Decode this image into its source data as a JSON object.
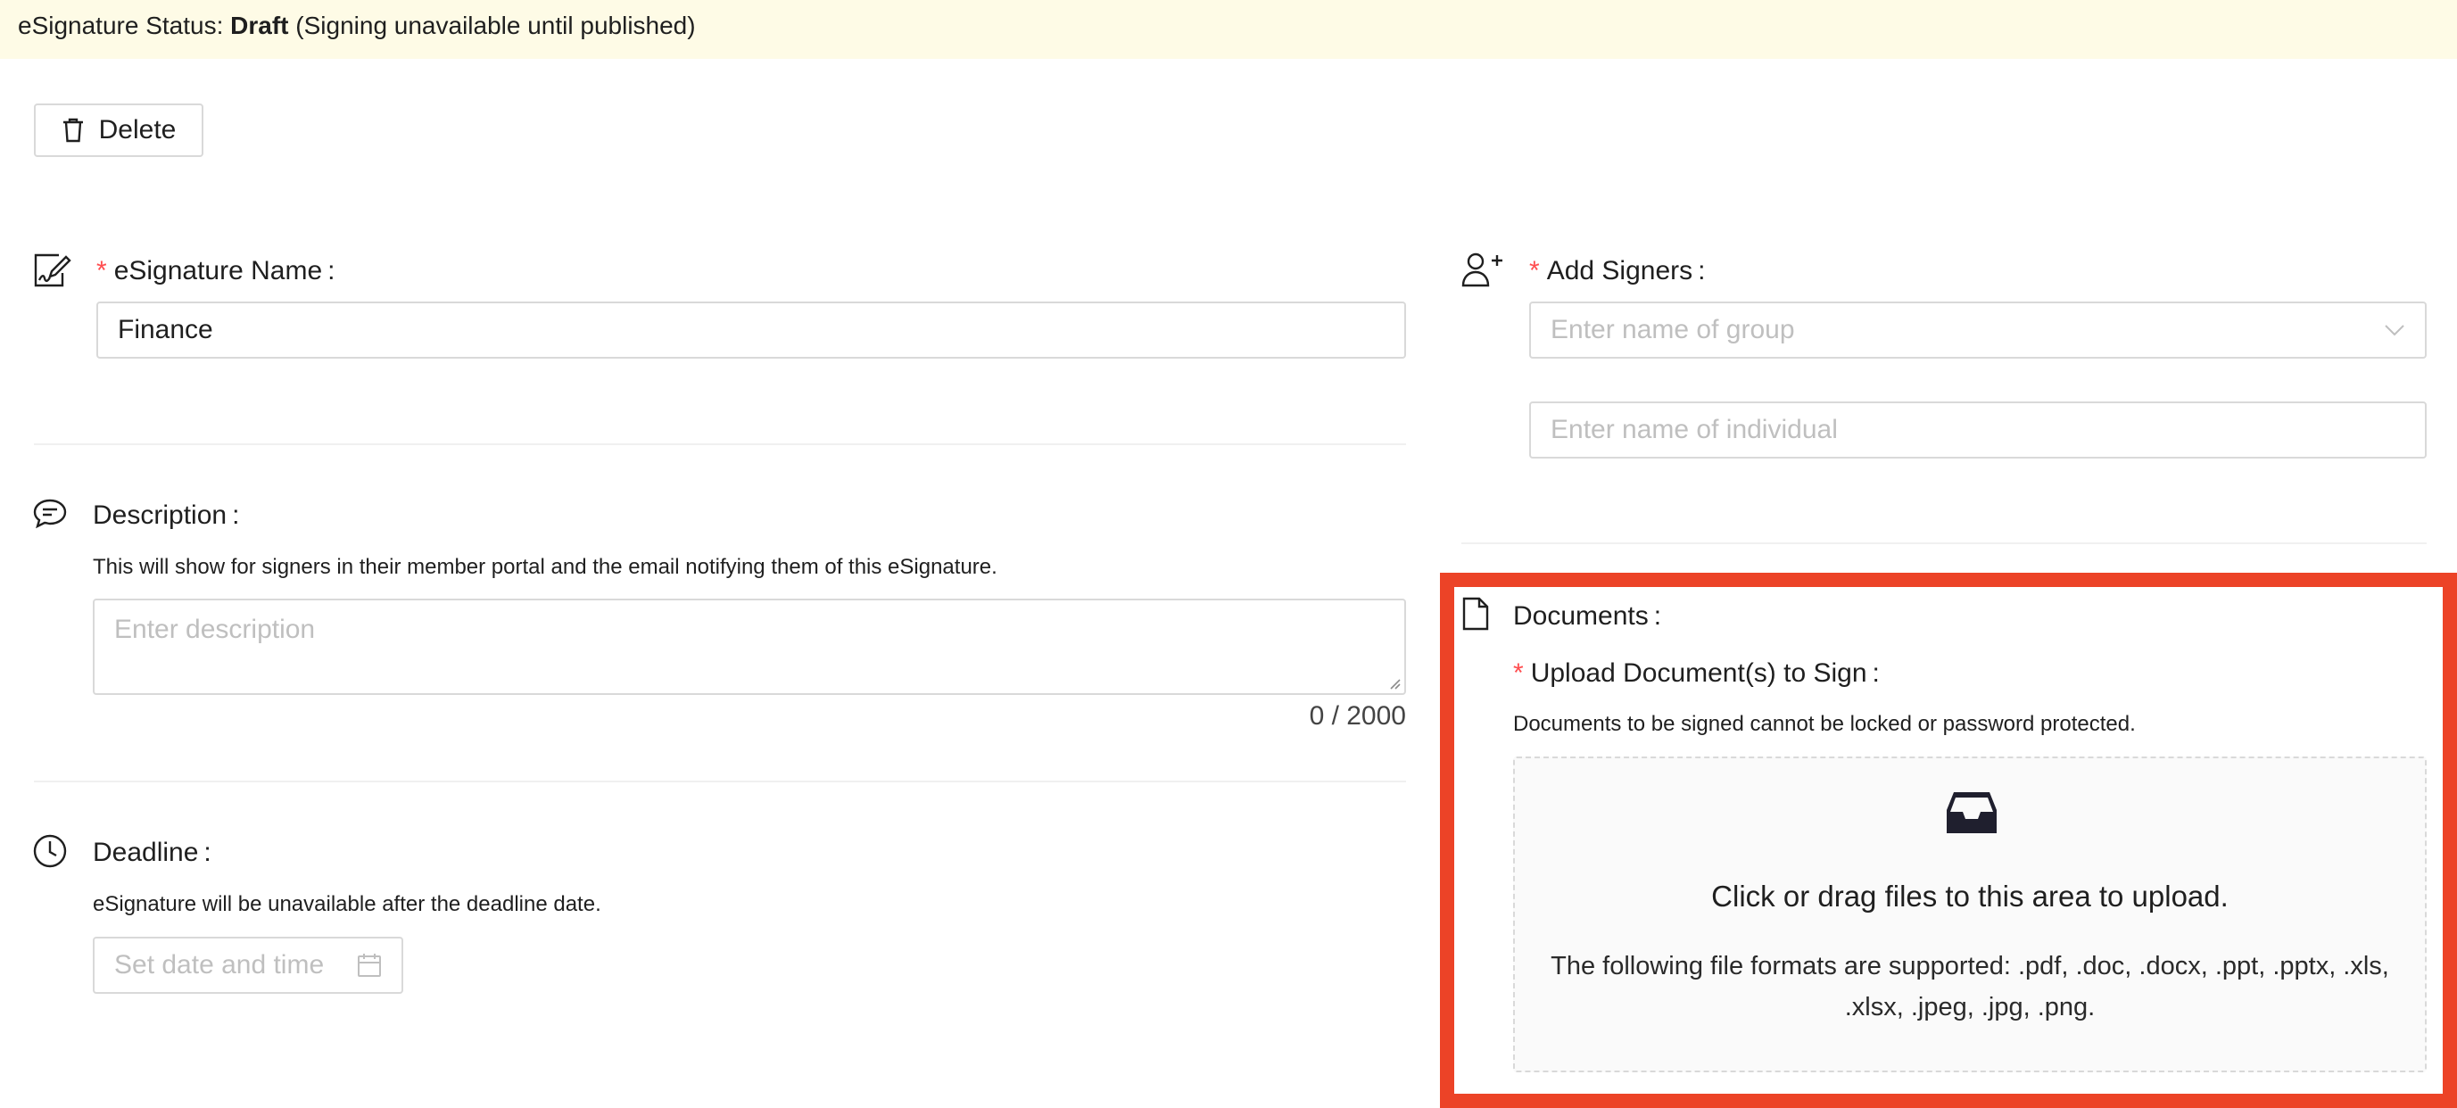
{
  "banner": {
    "prefix": "eSignature Status:",
    "status": "Draft",
    "suffix": "(Signing unavailable until published)"
  },
  "toolbar": {
    "delete_label": "Delete"
  },
  "name_field": {
    "label": "eSignature Name",
    "value": "Finance"
  },
  "description": {
    "label": "Description",
    "help": "This will show for signers in their member portal and the email notifying them of this eSignature.",
    "placeholder": "Enter description",
    "counter": "0 / 2000"
  },
  "deadline": {
    "label": "Deadline",
    "help": "eSignature will be unavailable after the deadline date.",
    "placeholder": "Set date and time"
  },
  "signers": {
    "label": "Add Signers",
    "group_placeholder": "Enter name of group",
    "individual_placeholder": "Enter name of individual"
  },
  "documents": {
    "label": "Documents",
    "upload_label": "Upload Document(s) to Sign",
    "help": "Documents to be signed cannot be locked or password protected.",
    "dropzone_title": "Click or drag files to this area to upload.",
    "dropzone_formats": "The following file formats are supported: .pdf, .doc, .docx, .ppt, .pptx, .xls, .xlsx, .jpeg, .jpg, .png."
  },
  "common": {
    "required_mark": "*",
    "colon": ":"
  },
  "colors": {
    "banner_bg": "#fefbe6",
    "required": "#ff4d4f",
    "highlight": "#ec4327"
  },
  "icons": [
    "trash-icon",
    "signature-edit-icon",
    "comment-icon",
    "clock-icon",
    "calendar-icon",
    "add-user-icon",
    "chevron-down-icon",
    "document-icon",
    "inbox-icon"
  ]
}
